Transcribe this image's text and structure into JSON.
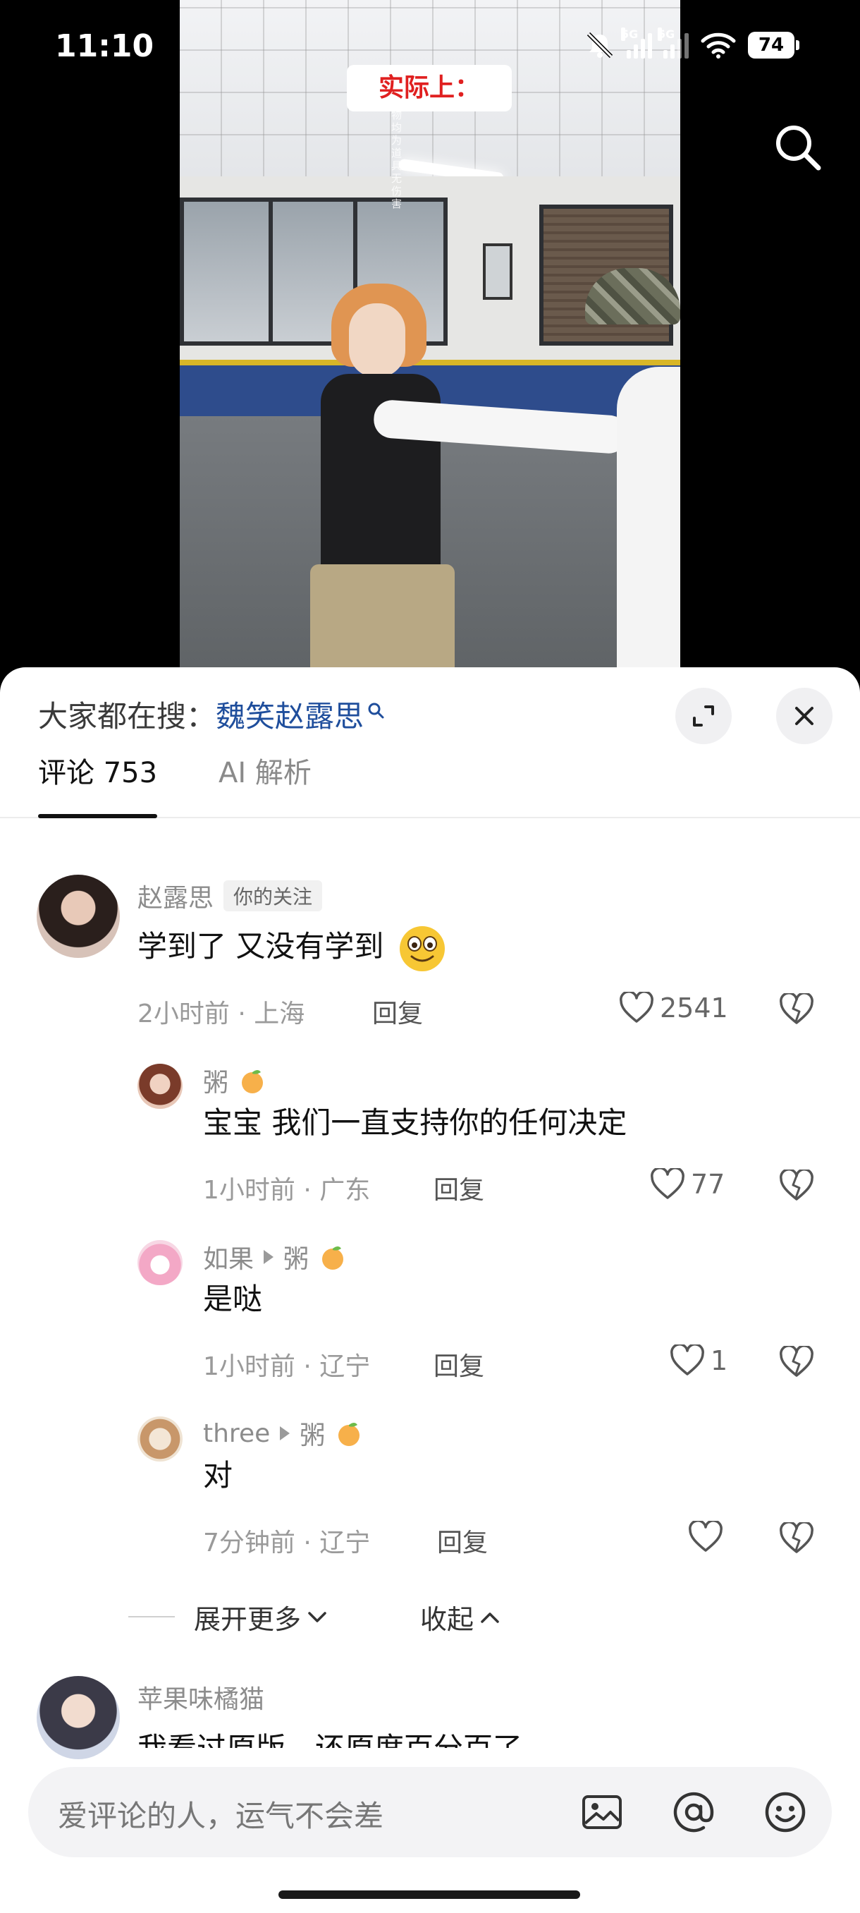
{
  "status_bar": {
    "time": "11:10",
    "network_1": "5G",
    "network_2": "5G",
    "battery": "74"
  },
  "video": {
    "caption": "实际上：",
    "side_note": "视频器物均为道具 无伤害"
  },
  "sheet": {
    "hot_search_label": "大家都在搜：",
    "hot_search_keyword": "魏笑赵露思",
    "tabs": [
      {
        "label": "评论 753"
      },
      {
        "label": "AI 解析"
      }
    ],
    "comments": [
      {
        "user": "赵露思",
        "badge": "你的关注",
        "text": "学到了 又没有学到",
        "time_location": "2小时前 · 上海",
        "reply_label": "回复",
        "likes": "2541"
      },
      {
        "user": "粥",
        "text": "宝宝 我们一直支持你的任何决定",
        "time_location": "1小时前 · 广东",
        "reply_label": "回复",
        "likes": "77"
      },
      {
        "user": "如果",
        "reply_to": "粥",
        "text": "是哒",
        "time_location": "1小时前 · 辽宁",
        "reply_label": "回复",
        "likes": "1"
      },
      {
        "user": "three",
        "reply_to": "粥",
        "text": "对",
        "time_location": "7分钟前 · 辽宁",
        "reply_label": "回复",
        "likes": ""
      },
      {
        "user": "苹果味橘猫",
        "text": "我看过原版，还原度百分百了"
      }
    ],
    "expand_more": "展开更多",
    "collapse": "收起"
  },
  "input": {
    "placeholder": "爱评论的人，运气不会差",
    "icons": [
      "image-icon",
      "at-icon",
      "emoji-icon"
    ]
  },
  "colors": {
    "keyword": "#1f4e9c",
    "caption_red": "#e02020",
    "sheet_bg": "#ffffff"
  }
}
